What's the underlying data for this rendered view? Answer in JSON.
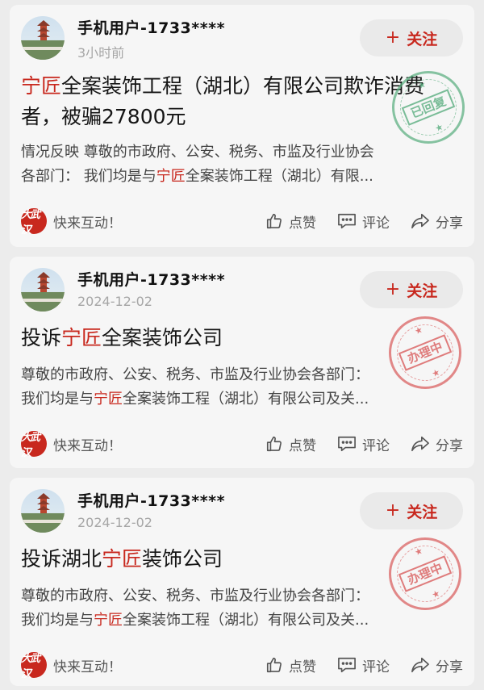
{
  "posts": [
    {
      "username": "手机用户-1733****",
      "time": "3小时前",
      "follow_label": "关注",
      "title": {
        "hl": "宁匠",
        "rest": "全案装饰工程（湖北）有限公司欺诈消费者，被骗27800元"
      },
      "summary": [
        {
          "pre": "情况反映  尊敬的市政府、公安、税务、市监及行业协会",
          "hl": "",
          "post": ""
        },
        {
          "pre": "各部门：  我们均是与",
          "hl": "宁匠",
          "post": "全案装饰工程（湖北）有限..."
        }
      ],
      "stamp": {
        "text": "已回复",
        "color": "green"
      },
      "brand_logo_text": "大武汉",
      "brand_text": "快来互动！",
      "actions": {
        "like": "点赞",
        "comment": "评论",
        "share": "分享"
      }
    },
    {
      "username": "手机用户-1733****",
      "time": "2024-12-02",
      "follow_label": "关注",
      "title": {
        "pre": "投诉",
        "hl": "宁匠",
        "rest": "全案装饰公司"
      },
      "summary": [
        {
          "pre": "尊敬的市政府、公安、税务、市监及行业协会各部门：",
          "hl": "",
          "post": ""
        },
        {
          "pre": "我们均是与",
          "hl": "宁匠",
          "post": "全案装饰工程（湖北）有限公司及关..."
        }
      ],
      "stamp": {
        "text": "办理中",
        "color": "red"
      },
      "brand_logo_text": "大武汉",
      "brand_text": "快来互动！",
      "actions": {
        "like": "点赞",
        "comment": "评论",
        "share": "分享"
      }
    },
    {
      "username": "手机用户-1733****",
      "time": "2024-12-02",
      "follow_label": "关注",
      "title": {
        "pre": "投诉湖北",
        "hl": "宁匠",
        "rest": "装饰公司"
      },
      "summary": [
        {
          "pre": "尊敬的市政府、公安、税务、市监及行业协会各部门：",
          "hl": "",
          "post": ""
        },
        {
          "pre": "我们均是与",
          "hl": "宁匠",
          "post": "全案装饰工程（湖北）有限公司及关..."
        }
      ],
      "stamp": {
        "text": "办理中",
        "color": "red"
      },
      "brand_logo_text": "大武汉",
      "brand_text": "快来互动！",
      "actions": {
        "like": "点赞",
        "comment": "评论",
        "share": "分享"
      }
    }
  ],
  "colors": {
    "accent": "#c8281e",
    "stamp_green": "#56ac7c",
    "stamp_red": "#d64c4c"
  },
  "icons": [
    "plus-icon",
    "thumbs-up-icon",
    "comment-icon",
    "share-icon"
  ]
}
